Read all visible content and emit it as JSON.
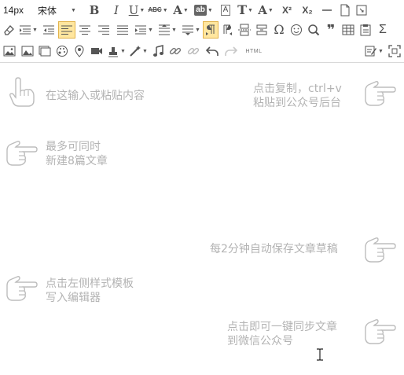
{
  "toolbar": {
    "font_size": "14px",
    "font_family": "宋体",
    "buttons": {
      "bold": "B",
      "italic": "I",
      "underline": "U",
      "strikethrough": "ABC",
      "font_color": "A",
      "highlight": "ab",
      "clear_format": "A",
      "text_style": "T",
      "scale_text": "A",
      "superscript": "X²",
      "subscript": "X₂",
      "omega": "Ω",
      "quote": "❞",
      "sigma": "Σ",
      "html": "HTML"
    }
  },
  "hints": {
    "input": "在这输入或粘贴内容",
    "copy_line1": "点击复制，ctrl+v",
    "copy_line2": "粘贴到公众号后台",
    "multi_line1": "最多可同时",
    "multi_line2": "新建8篇文章",
    "autosave": "每2分钟自动保存文章草稿",
    "template_line1": "点击左侧样式模板",
    "template_line2": "写入编辑器",
    "sync_line1": "点击即可一键同步文章",
    "sync_line2": "到微信公众号"
  },
  "colors": {
    "hint_text": "#b3b3b3",
    "active_button_bg": "#ffe69f",
    "active_button_border": "#e3b34a",
    "icon": "#4f4f4f"
  }
}
